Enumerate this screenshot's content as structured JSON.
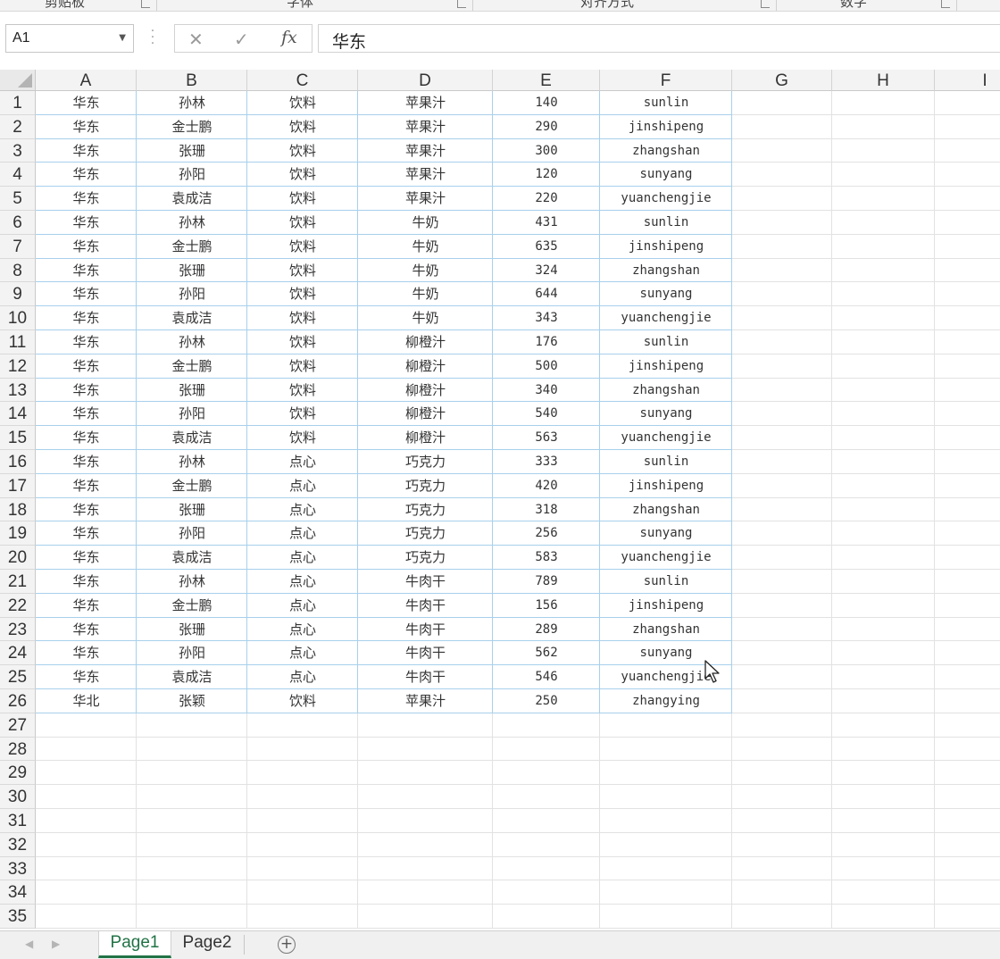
{
  "ribbon": {
    "groups": [
      {
        "label": "剪贴板"
      },
      {
        "label": "字体"
      },
      {
        "label": "对齐方式"
      },
      {
        "label": "数字"
      }
    ]
  },
  "formula_bar": {
    "name_box": "A1",
    "cancel_icon": "✕",
    "enter_icon": "✓",
    "fx_label": "fx",
    "content": "华东"
  },
  "columns": [
    "A",
    "B",
    "C",
    "D",
    "E",
    "F",
    "G",
    "H",
    "I"
  ],
  "rows": [
    [
      "华东",
      "孙林",
      "饮料",
      "苹果汁",
      "140",
      "sunlin"
    ],
    [
      "华东",
      "金士鹏",
      "饮料",
      "苹果汁",
      "290",
      "jinshipeng"
    ],
    [
      "华东",
      "张珊",
      "饮料",
      "苹果汁",
      "300",
      "zhangshan"
    ],
    [
      "华东",
      "孙阳",
      "饮料",
      "苹果汁",
      "120",
      "sunyang"
    ],
    [
      "华东",
      "袁成洁",
      "饮料",
      "苹果汁",
      "220",
      "yuanchengjie"
    ],
    [
      "华东",
      "孙林",
      "饮料",
      "牛奶",
      "431",
      "sunlin"
    ],
    [
      "华东",
      "金士鹏",
      "饮料",
      "牛奶",
      "635",
      "jinshipeng"
    ],
    [
      "华东",
      "张珊",
      "饮料",
      "牛奶",
      "324",
      "zhangshan"
    ],
    [
      "华东",
      "孙阳",
      "饮料",
      "牛奶",
      "644",
      "sunyang"
    ],
    [
      "华东",
      "袁成洁",
      "饮料",
      "牛奶",
      "343",
      "yuanchengjie"
    ],
    [
      "华东",
      "孙林",
      "饮料",
      "柳橙汁",
      "176",
      "sunlin"
    ],
    [
      "华东",
      "金士鹏",
      "饮料",
      "柳橙汁",
      "500",
      "jinshipeng"
    ],
    [
      "华东",
      "张珊",
      "饮料",
      "柳橙汁",
      "340",
      "zhangshan"
    ],
    [
      "华东",
      "孙阳",
      "饮料",
      "柳橙汁",
      "540",
      "sunyang"
    ],
    [
      "华东",
      "袁成洁",
      "饮料",
      "柳橙汁",
      "563",
      "yuanchengjie"
    ],
    [
      "华东",
      "孙林",
      "点心",
      "巧克力",
      "333",
      "sunlin"
    ],
    [
      "华东",
      "金士鹏",
      "点心",
      "巧克力",
      "420",
      "jinshipeng"
    ],
    [
      "华东",
      "张珊",
      "点心",
      "巧克力",
      "318",
      "zhangshan"
    ],
    [
      "华东",
      "孙阳",
      "点心",
      "巧克力",
      "256",
      "sunyang"
    ],
    [
      "华东",
      "袁成洁",
      "点心",
      "巧克力",
      "583",
      "yuanchengjie"
    ],
    [
      "华东",
      "孙林",
      "点心",
      "牛肉干",
      "789",
      "sunlin"
    ],
    [
      "华东",
      "金士鹏",
      "点心",
      "牛肉干",
      "156",
      "jinshipeng"
    ],
    [
      "华东",
      "张珊",
      "点心",
      "牛肉干",
      "289",
      "zhangshan"
    ],
    [
      "华东",
      "孙阳",
      "点心",
      "牛肉干",
      "562",
      "sunyang"
    ],
    [
      "华东",
      "袁成洁",
      "点心",
      "牛肉干",
      "546",
      "yuanchengjie"
    ],
    [
      "华北",
      "张颖",
      "饮料",
      "苹果汁",
      "250",
      "zhangying"
    ]
  ],
  "row_numbers": [
    "1",
    "2",
    "3",
    "4",
    "5",
    "6",
    "7",
    "8",
    "9",
    "10",
    "11",
    "12",
    "13",
    "14",
    "15",
    "16",
    "17",
    "18",
    "19",
    "20",
    "21",
    "22",
    "23",
    "24",
    "25",
    "26",
    "27",
    "28",
    "29",
    "30",
    "31",
    "32",
    "33",
    "34",
    "35"
  ],
  "sheet_tabs": [
    {
      "label": "Page1",
      "active": true
    },
    {
      "label": "Page2",
      "active": false
    }
  ],
  "add_sheet_label": "+",
  "colors": {
    "accent": "#217346",
    "data_border": "#a8d0ec",
    "header_bg": "#f3f3f3"
  }
}
